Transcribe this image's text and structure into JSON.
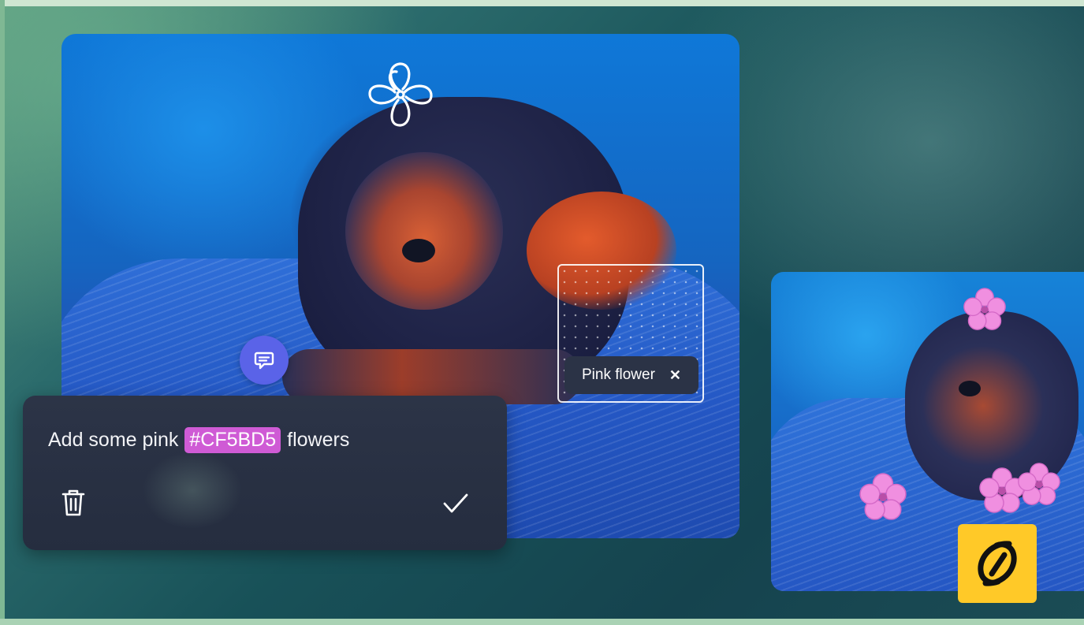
{
  "prompt": {
    "prefix": "Add some pink",
    "color_token": "#CF5BD5",
    "suffix": "flowers"
  },
  "selection": {
    "tag_label": "Pink flower",
    "close_glyph": "✕"
  },
  "icons": {
    "comment": "comment-icon",
    "trash": "trash-icon",
    "check": "check-icon",
    "flower_sketch": "flower-sketch-icon",
    "logo": "app-logo-icon"
  },
  "colors": {
    "accent_pink": "#CF5BD5",
    "comment_bubble": "#5A63E8",
    "logo_bg": "#FFC928",
    "panel_bg": "#2C3447"
  }
}
